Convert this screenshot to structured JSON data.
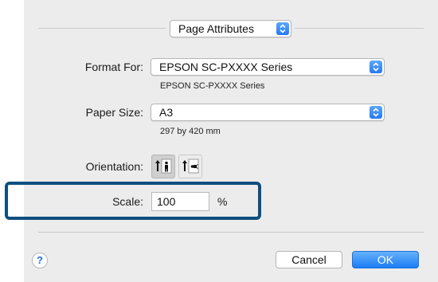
{
  "header": {
    "section_label": "Page Attributes"
  },
  "format": {
    "label": "Format For:",
    "value": "EPSON SC-PXXXX Series",
    "sub": "EPSON SC-PXXXX Series"
  },
  "paper": {
    "label": "Paper Size:",
    "value": "A3",
    "sub": "297 by 420 mm"
  },
  "orientation": {
    "label": "Orientation:",
    "selected": "portrait"
  },
  "scale": {
    "label": "Scale:",
    "value": "100",
    "unit": "%"
  },
  "footer": {
    "help": "?",
    "cancel": "Cancel",
    "ok": "OK"
  },
  "colors": {
    "accent": "#2879f3",
    "highlight": "#0e4f80"
  },
  "icons": [
    "help-icon",
    "portrait-icon",
    "landscape-icon",
    "stepper-icon"
  ]
}
